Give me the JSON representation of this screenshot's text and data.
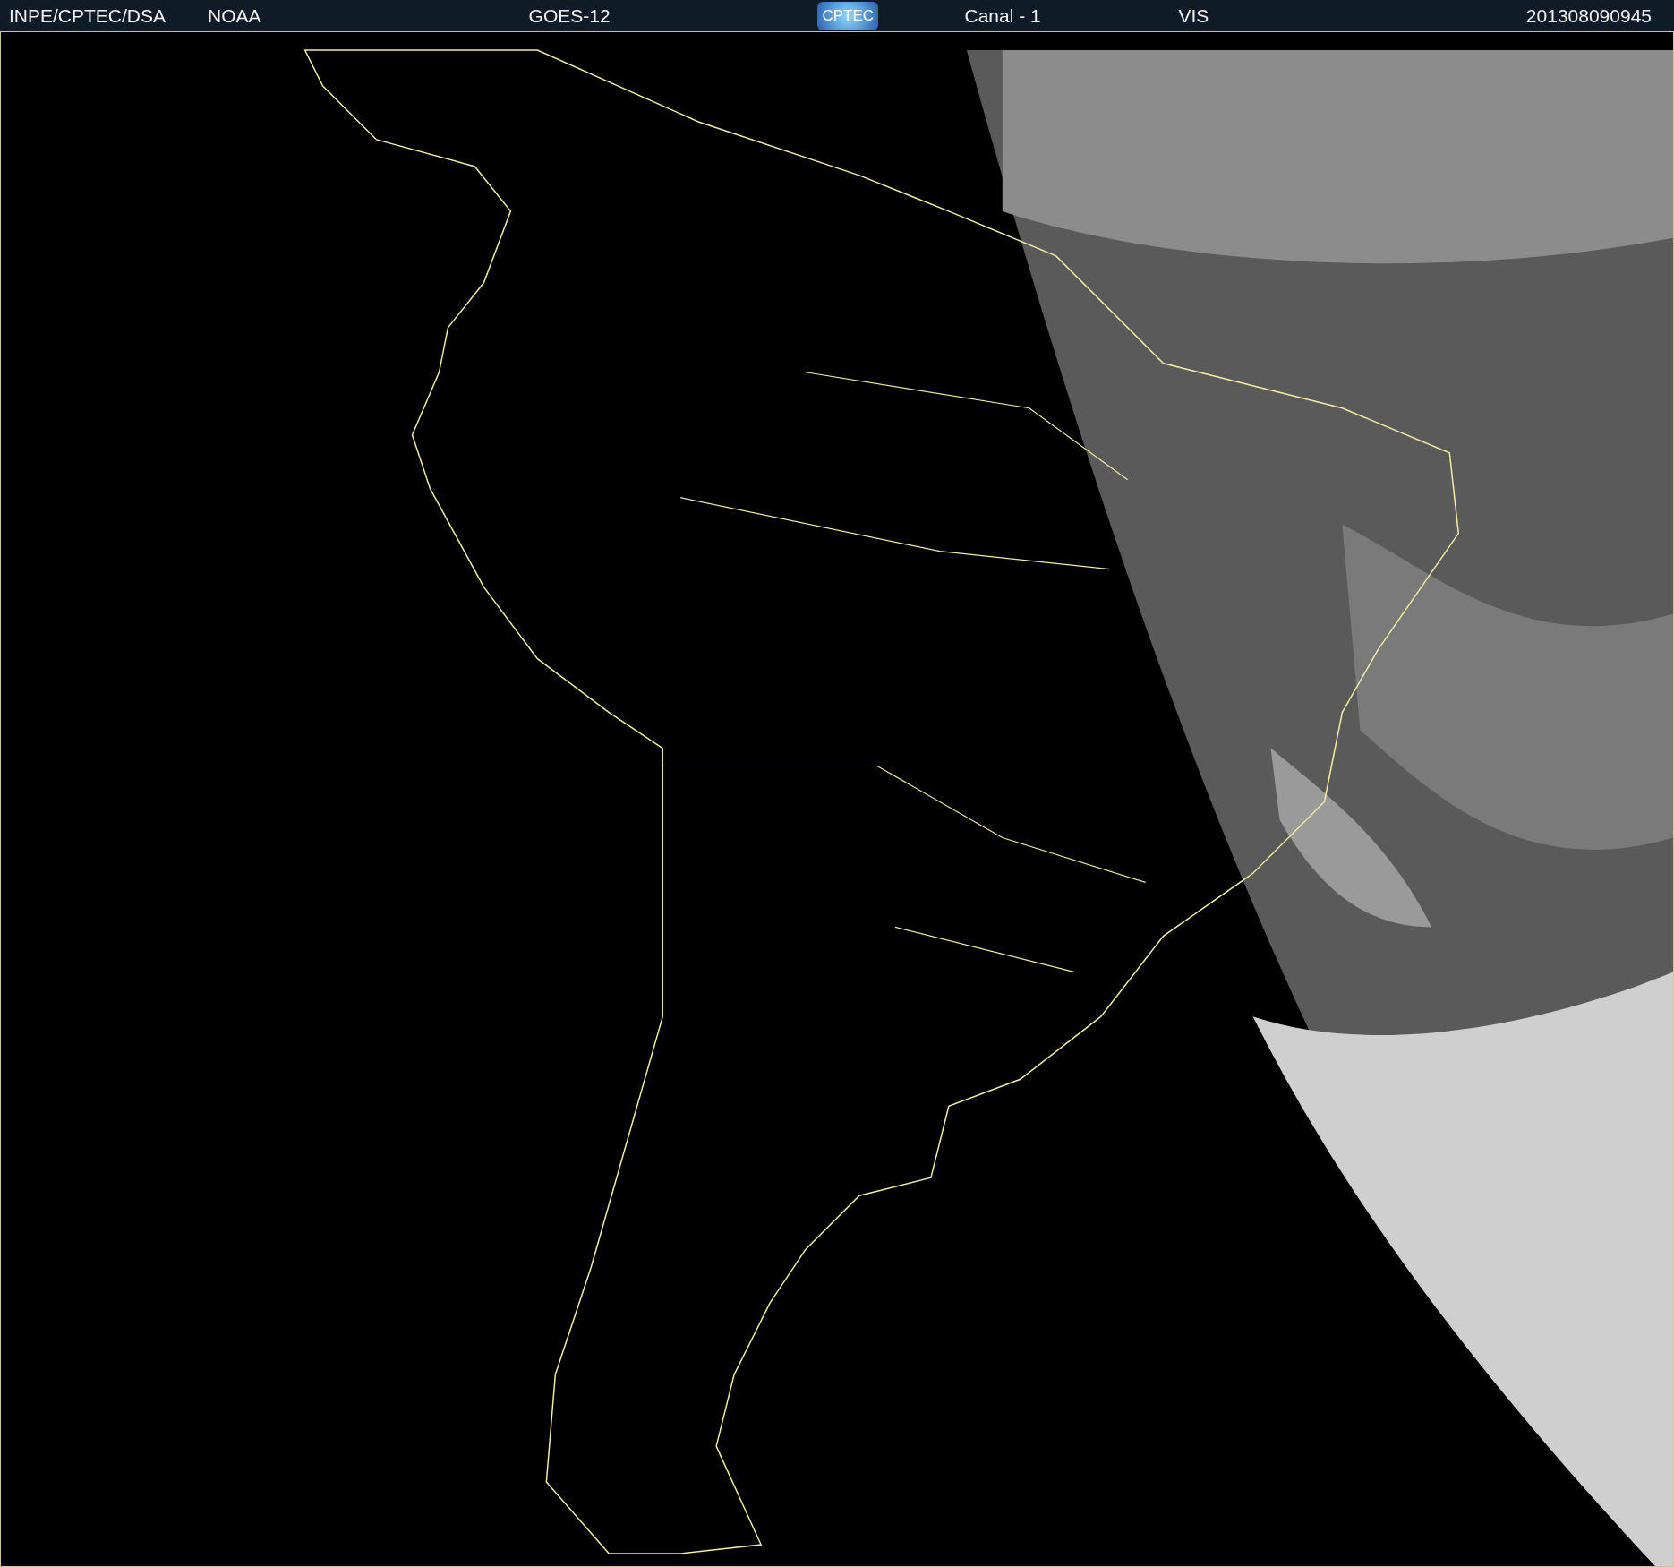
{
  "header": {
    "items": [
      {
        "kind": "text",
        "text": "INPE/CPTEC/DSA"
      },
      {
        "kind": "text",
        "text": "NOAA"
      },
      {
        "kind": "text",
        "text": "GOES-12"
      },
      {
        "kind": "logo",
        "text": "CPTEC"
      },
      {
        "kind": "text",
        "text": "Canal - 1"
      },
      {
        "kind": "text",
        "text": "VIS"
      },
      {
        "kind": "text",
        "text": "201308090945"
      }
    ]
  }
}
